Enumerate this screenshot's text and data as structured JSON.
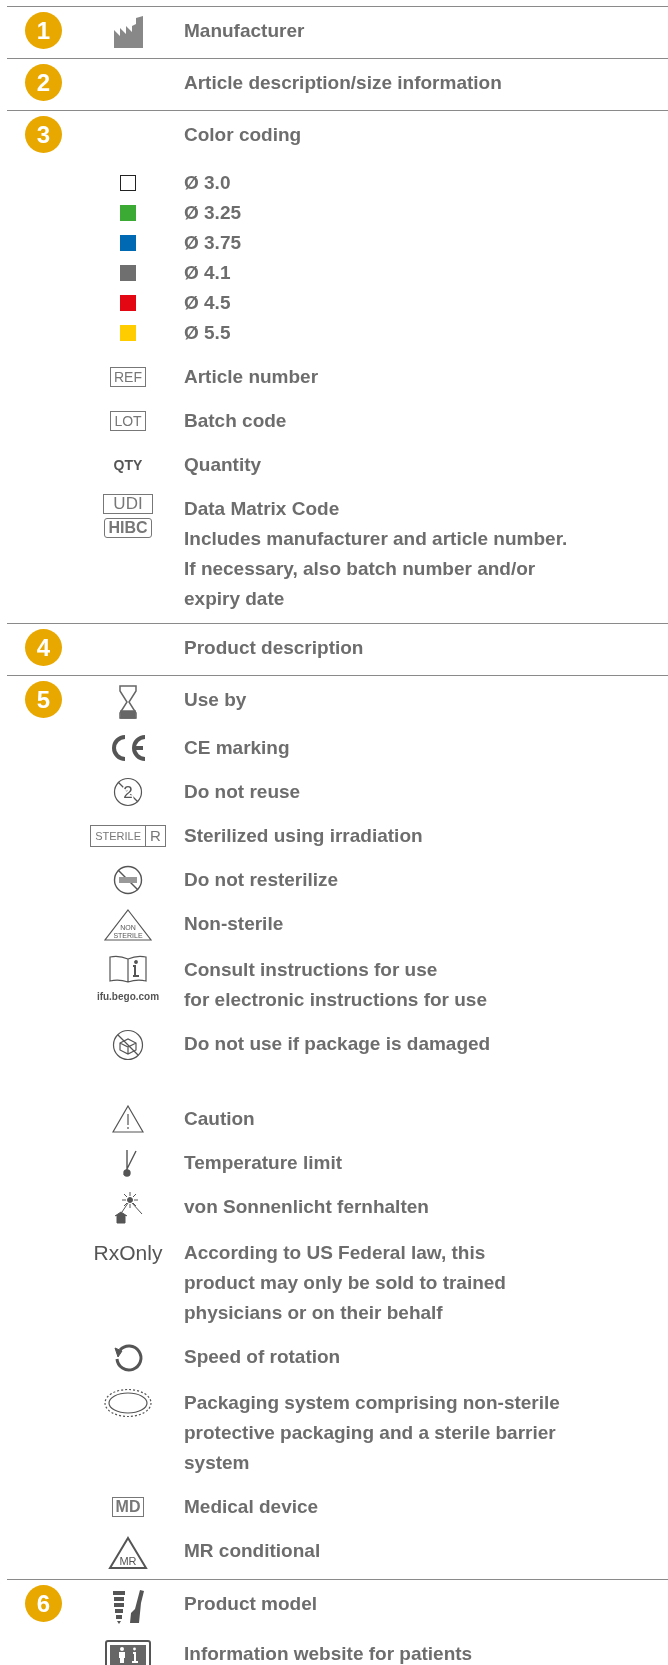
{
  "sections": [
    {
      "number": "1",
      "groups": [
        {
          "rows": [
            {
              "kind": "factory",
              "lines": [
                "Manufacturer"
              ]
            }
          ]
        }
      ]
    },
    {
      "number": "2",
      "groups": [
        {
          "rows": [
            {
              "kind": "none",
              "lines": [
                "Article description/size information"
              ]
            }
          ]
        }
      ]
    },
    {
      "number": "3",
      "groups": [
        {
          "rows": [
            {
              "kind": "none",
              "lines": [
                "Color coding"
              ]
            },
            {
              "kind": "swatch",
              "color": "#ffffff",
              "lines": [
                "Ø 3.0"
              ]
            },
            {
              "kind": "swatch",
              "color": "#3aaa35",
              "lines": [
                "Ø 3.25"
              ]
            },
            {
              "kind": "swatch",
              "color": "#0069b4",
              "lines": [
                "Ø 3.75"
              ]
            },
            {
              "kind": "swatch",
              "color": "#6f6f6f",
              "lines": [
                "Ø 4.1"
              ]
            },
            {
              "kind": "swatch",
              "color": "#e30613",
              "lines": [
                "Ø 4.5"
              ]
            },
            {
              "kind": "swatch",
              "color": "#ffcc00",
              "lines": [
                "Ø 5.5"
              ]
            },
            {
              "kind": "boxed",
              "icon_text": [
                "REF"
              ],
              "lines": [
                "Article number"
              ]
            },
            {
              "kind": "boxed",
              "icon_text": [
                "LOT"
              ],
              "lines": [
                "Batch code"
              ]
            },
            {
              "kind": "plain",
              "icon_text": [
                "QTY"
              ],
              "lines": [
                "Quantity"
              ]
            },
            {
              "kind": "udi",
              "icon_text": [
                "UDI",
                "HIBC"
              ],
              "lines": [
                "Data Matrix Code",
                "Includes manufacturer and article number.",
                "If necessary, also batch number and/or",
                "expiry date"
              ]
            }
          ]
        }
      ]
    },
    {
      "number": "4",
      "groups": [
        {
          "rows": [
            {
              "kind": "none",
              "lines": [
                "Product description"
              ]
            }
          ]
        }
      ]
    },
    {
      "number": "5",
      "groups": [
        {
          "rows": [
            {
              "kind": "hourglass",
              "lines": [
                "Use by"
              ]
            },
            {
              "kind": "ce",
              "lines": [
                "CE marking"
              ]
            },
            {
              "kind": "no-reuse",
              "icon_text": [
                "2"
              ],
              "lines": [
                "Do not reuse"
              ]
            },
            {
              "kind": "sterile",
              "icon_text": [
                "STERILE",
                "R"
              ],
              "lines": [
                "Sterilized using irradiation"
              ]
            },
            {
              "kind": "no-resterilize",
              "lines": [
                "Do not resterilize"
              ]
            },
            {
              "kind": "non-sterile",
              "icon_text": [
                "NON",
                "STERILE"
              ],
              "lines": [
                "Non-sterile"
              ]
            },
            {
              "kind": "book",
              "icon_text": [
                "ifu.bego.com"
              ],
              "lines": [
                "Consult instructions for use",
                "for electronic instructions for use"
              ]
            },
            {
              "kind": "damaged",
              "lines": [
                "Do not use if package is damaged"
              ]
            }
          ]
        },
        {
          "rows": [
            {
              "kind": "caution",
              "lines": [
                "Caution"
              ]
            },
            {
              "kind": "thermometer",
              "lines": [
                "Temperature limit"
              ]
            },
            {
              "kind": "sun",
              "lines": [
                "von Sonnenlicht fernhalten"
              ]
            },
            {
              "kind": "rx",
              "icon_text": [
                "RxOnly"
              ],
              "lines": [
                "According to US Federal law, this",
                "product may only be sold to trained",
                "physicians or on their behalf"
              ]
            },
            {
              "kind": "rotation",
              "lines": [
                "Speed of rotation"
              ]
            },
            {
              "kind": "ellipse",
              "lines": [
                "Packaging system comprising non-sterile",
                "protective packaging and a sterile barrier",
                "system"
              ]
            },
            {
              "kind": "boxed",
              "icon_text": [
                "MD"
              ],
              "lines": [
                "Medical device"
              ]
            },
            {
              "kind": "mr",
              "icon_text": [
                "MR"
              ],
              "lines": [
                "MR conditional"
              ]
            }
          ]
        }
      ]
    },
    {
      "number": "6",
      "groups": [
        {
          "rows": [
            {
              "kind": "model",
              "lines": [
                "Product model"
              ]
            },
            {
              "kind": "laptop",
              "lines": [
                "Information website for patients"
              ]
            }
          ]
        }
      ]
    }
  ]
}
